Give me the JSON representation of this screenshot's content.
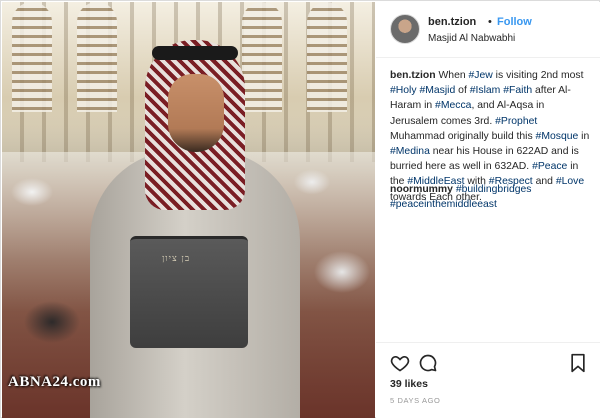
{
  "photo": {
    "pouch_text": "בן ציון",
    "watermark": "ABNA24.com"
  },
  "header": {
    "username": "ben.tzion",
    "separator": "•",
    "follow_label": "Follow",
    "location": "Masjid Al Nabwabhi",
    "avatar_icon": "profile-avatar"
  },
  "caption": {
    "username": "ben.tzion",
    "segments": [
      {
        "t": "When ",
        "tag": false
      },
      {
        "t": "#Jew",
        "tag": true
      },
      {
        "t": " is visiting 2nd most ",
        "tag": false
      },
      {
        "t": "#Holy",
        "tag": true
      },
      {
        "t": " ",
        "tag": false
      },
      {
        "t": "#Masjid",
        "tag": true
      },
      {
        "t": " of ",
        "tag": false
      },
      {
        "t": "#Islam",
        "tag": true
      },
      {
        "t": " ",
        "tag": false
      },
      {
        "t": "#Faith",
        "tag": true
      },
      {
        "t": " after Al-Haram in ",
        "tag": false
      },
      {
        "t": "#Mecca",
        "tag": true
      },
      {
        "t": ", and Al-Aqsa in Jerusalem comes 3rd. ",
        "tag": false
      },
      {
        "t": "#Prophet",
        "tag": true
      },
      {
        "t": " Muhammad originally build this ",
        "tag": false
      },
      {
        "t": "#Mosque",
        "tag": true
      },
      {
        "t": " in ",
        "tag": false
      },
      {
        "t": "#Medina",
        "tag": true
      },
      {
        "t": " near his House in 622AD and is burried here as well in 632AD. ",
        "tag": false
      },
      {
        "t": "#Peace",
        "tag": true
      },
      {
        "t": " in the ",
        "tag": false
      },
      {
        "t": "#MiddleEast",
        "tag": true
      },
      {
        "t": " with ",
        "tag": false
      },
      {
        "t": "#Respect",
        "tag": true
      },
      {
        "t": " and ",
        "tag": false
      },
      {
        "t": "#Love",
        "tag": true
      },
      {
        "t": " towards Each other.",
        "tag": false
      }
    ]
  },
  "comment": {
    "username": "noormummy",
    "tags": [
      "#buildingbridges",
      "#peaceinthemiddleeast"
    ]
  },
  "actions": {
    "like_icon": "heart-icon",
    "comment_icon": "comment-bubble-icon",
    "save_icon": "bookmark-icon"
  },
  "likes": "39 likes",
  "time": "5 DAYS AGO",
  "colors": {
    "link_blue": "#3897f0",
    "hashtag": "#003569",
    "text": "#262626",
    "muted": "#999999",
    "border": "#dbdbdb"
  }
}
